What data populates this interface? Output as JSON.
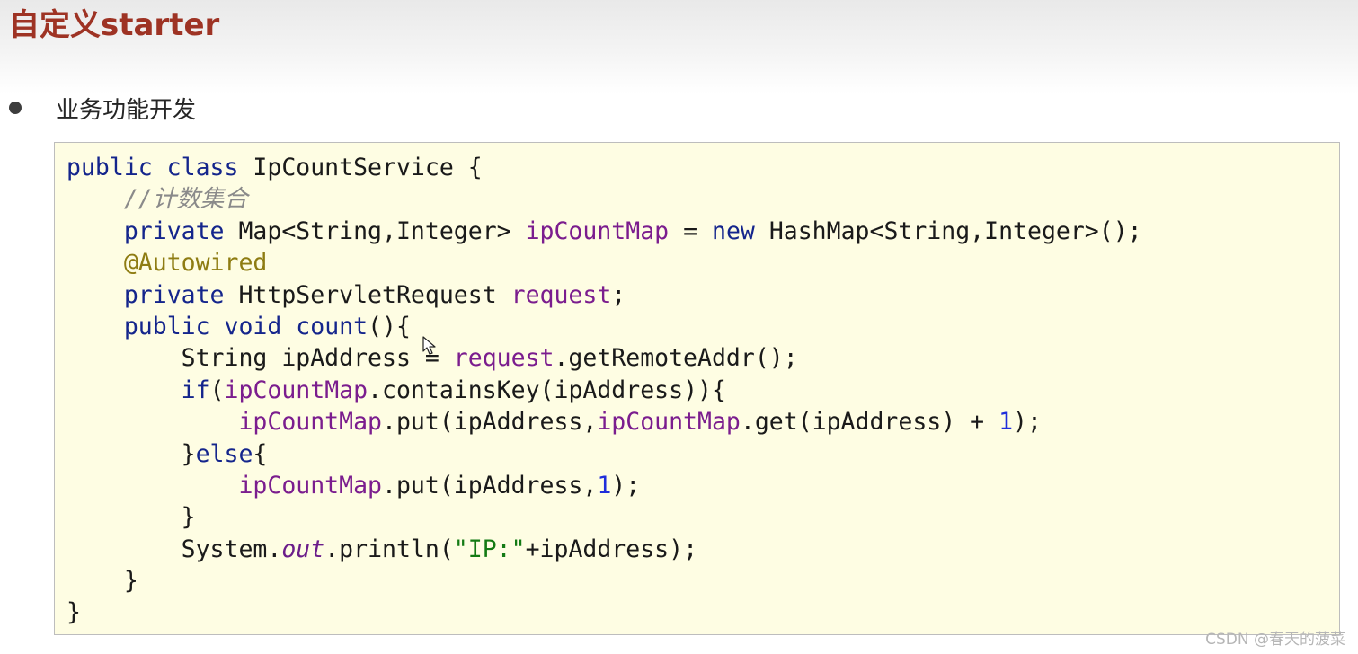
{
  "slide": {
    "title": "自定义starter",
    "bullet": "业务功能开发"
  },
  "code": {
    "lines": [
      [
        {
          "t": "public class",
          "k": "keyword"
        },
        {
          "t": " IpCountService {",
          "k": "plain"
        }
      ],
      [
        {
          "t": "    ",
          "k": "plain"
        },
        {
          "t": "//计数集合",
          "k": "comment"
        }
      ],
      [
        {
          "t": "    ",
          "k": "plain"
        },
        {
          "t": "private",
          "k": "keyword"
        },
        {
          "t": " Map<String,Integer> ",
          "k": "plain"
        },
        {
          "t": "ipCountMap",
          "k": "field"
        },
        {
          "t": " = ",
          "k": "plain"
        },
        {
          "t": "new",
          "k": "keyword"
        },
        {
          "t": " HashMap<String,Integer>();",
          "k": "plain"
        }
      ],
      [
        {
          "t": "    ",
          "k": "plain"
        },
        {
          "t": "@Autowired",
          "k": "annotation"
        }
      ],
      [
        {
          "t": "    ",
          "k": "plain"
        },
        {
          "t": "private",
          "k": "keyword"
        },
        {
          "t": " HttpServletRequest ",
          "k": "plain"
        },
        {
          "t": "request",
          "k": "field"
        },
        {
          "t": ";",
          "k": "plain"
        }
      ],
      [
        {
          "t": "    ",
          "k": "plain"
        },
        {
          "t": "public void",
          "k": "keyword"
        },
        {
          "t": " ",
          "k": "plain"
        },
        {
          "t": "count",
          "k": "keyword"
        },
        {
          "t": "(){",
          "k": "plain"
        }
      ],
      [
        {
          "t": "        String ipAddress = ",
          "k": "plain"
        },
        {
          "t": "request",
          "k": "field"
        },
        {
          "t": ".getRemoteAddr();",
          "k": "plain"
        }
      ],
      [
        {
          "t": "        ",
          "k": "plain"
        },
        {
          "t": "if",
          "k": "keyword"
        },
        {
          "t": "(",
          "k": "plain"
        },
        {
          "t": "ipCountMap",
          "k": "field"
        },
        {
          "t": ".containsKey(ipAddress)){",
          "k": "plain"
        }
      ],
      [
        {
          "t": "            ",
          "k": "plain"
        },
        {
          "t": "ipCountMap",
          "k": "field"
        },
        {
          "t": ".put(ipAddress,",
          "k": "plain"
        },
        {
          "t": "ipCountMap",
          "k": "field"
        },
        {
          "t": ".get(ipAddress) + ",
          "k": "plain"
        },
        {
          "t": "1",
          "k": "number"
        },
        {
          "t": ");",
          "k": "plain"
        }
      ],
      [
        {
          "t": "        }",
          "k": "plain"
        },
        {
          "t": "else",
          "k": "keyword"
        },
        {
          "t": "{",
          "k": "plain"
        }
      ],
      [
        {
          "t": "            ",
          "k": "plain"
        },
        {
          "t": "ipCountMap",
          "k": "field"
        },
        {
          "t": ".put(ipAddress,",
          "k": "plain"
        },
        {
          "t": "1",
          "k": "number"
        },
        {
          "t": ");",
          "k": "plain"
        }
      ],
      [
        {
          "t": "        }",
          "k": "plain"
        }
      ],
      [
        {
          "t": "        System.",
          "k": "plain"
        },
        {
          "t": "out",
          "k": "static"
        },
        {
          "t": ".println(",
          "k": "plain"
        },
        {
          "t": "\"IP:\"",
          "k": "string"
        },
        {
          "t": "+ipAddress);",
          "k": "plain"
        }
      ],
      [
        {
          "t": "    }",
          "k": "plain"
        }
      ],
      [
        {
          "t": "}",
          "k": "plain"
        }
      ]
    ]
  },
  "watermark": "CSDN @春天的菠菜",
  "icons": {
    "bullet": "bullet-dot-icon",
    "cursor": "mouse-pointer-icon"
  }
}
